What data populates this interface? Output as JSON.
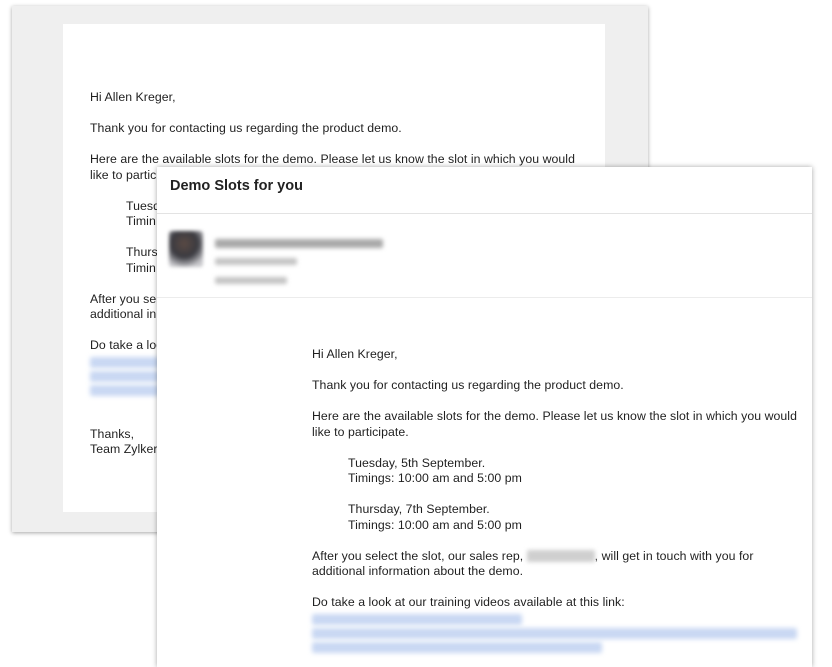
{
  "back_email": {
    "greeting": "Hi Allen Kreger,",
    "thanks_line": "Thank you for contacting us regarding the product demo.",
    "slots_line1": "Here are the available slots for the demo. Please let us know the slot in which you would",
    "slots_line2": "like to partic",
    "slot1_day": "Tuesd",
    "slot1_time": "Timin",
    "slot2_day": "Thurs",
    "slot2_time": "Timin",
    "after_line1": "After you se",
    "after_line2": "additional in",
    "videos_line": "Do take a loo",
    "signoff": "Thanks,",
    "team": "Team Zylker."
  },
  "email": {
    "subject": "Demo Slots for you",
    "greeting": "Hi Allen Kreger,",
    "thanks_line": "Thank you for contacting us regarding the product demo.",
    "slots_line1": "Here are the available slots for the demo. Please let us know the slot in which you would",
    "slots_line2": "like to participate.",
    "slot1_day": "Tuesday, 5th September.",
    "slot1_time": "Timings: 10:00 am and 5:00 pm",
    "slot2_day": "Thursday, 7th September.",
    "slot2_time": "Timings: 10:00 am and 5:00 pm",
    "after_prefix": "After you select the slot, our sales rep, ",
    "after_suffix": ", will get in touch with you for",
    "after_line2": "additional information about the demo.",
    "videos_line": "Do take a look at our training videos available at this link:"
  },
  "colors": {
    "link_blur": "#c9d8f3",
    "back_window_bg": "#efefef"
  }
}
